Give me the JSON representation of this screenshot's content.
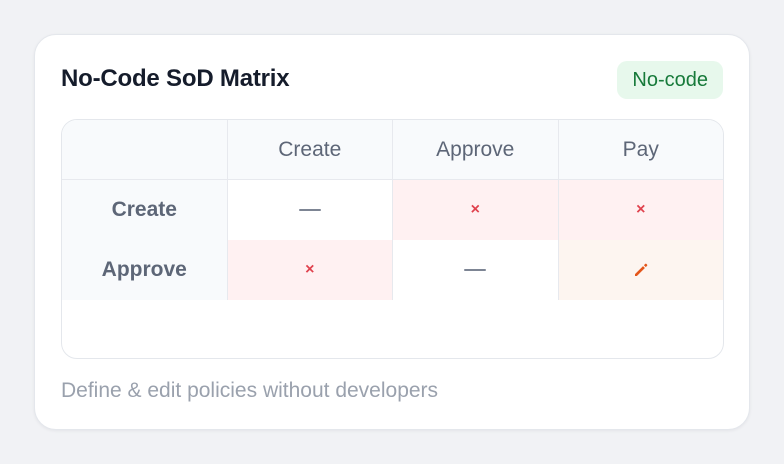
{
  "card": {
    "title": "No-Code SoD Matrix",
    "badge": "No-code",
    "footer": "Define & edit policies without developers"
  },
  "matrix": {
    "columns": [
      "Create",
      "Approve",
      "Pay"
    ],
    "rows": [
      {
        "label": "Create",
        "cells": [
          "none",
          "conflict",
          "conflict"
        ]
      },
      {
        "label": "Approve",
        "cells": [
          "conflict",
          "none",
          "edit"
        ]
      }
    ],
    "cell_glyphs": {
      "none": "—",
      "conflict": "×",
      "edit": "pencil-icon"
    }
  },
  "colors": {
    "badge_bg": "#e7f8ec",
    "badge_text": "#177a3a",
    "conflict_bg": "#fff1f2",
    "conflict_mark": "#e0424e",
    "edit_bg": "#fdf5f0",
    "edit_icon": "#e4561a"
  }
}
